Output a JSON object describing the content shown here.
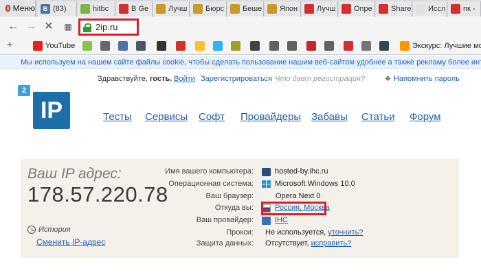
{
  "browser": {
    "menu_label": "Меню",
    "tabs": [
      {
        "label": "(83)",
        "icon": "vk-icon",
        "color": "#4c75a3",
        "glyph": "B"
      },
      {
        "label": "hitbc",
        "icon": "android-icon",
        "color": "#7cb342",
        "glyph": ""
      },
      {
        "label": "В Ge",
        "icon": "red-logo-icon",
        "color": "#d32f2f",
        "glyph": ""
      },
      {
        "label": "Лучш",
        "icon": "coin-icon",
        "color": "#c79a2b",
        "glyph": ""
      },
      {
        "label": "Бюрс",
        "icon": "coin-icon",
        "color": "#c79a2b",
        "glyph": ""
      },
      {
        "label": "Беше",
        "icon": "coin-icon",
        "color": "#c79a2b",
        "glyph": ""
      },
      {
        "label": "Япон",
        "icon": "coin-icon",
        "color": "#c79a2b",
        "glyph": ""
      },
      {
        "label": "Лучш",
        "icon": "red-logo-icon",
        "color": "#d32f2f",
        "glyph": ""
      },
      {
        "label": "Опре",
        "icon": "red-logo-icon",
        "color": "#d32f2f",
        "glyph": ""
      },
      {
        "label": "Share",
        "icon": "red-logo-icon",
        "color": "#d32f2f",
        "glyph": ""
      },
      {
        "label": "Иссл",
        "icon": "sun-icon",
        "color": "#e0e0e0",
        "glyph": ""
      },
      {
        "label": "пк -",
        "icon": "red-circle-icon",
        "color": "#d32f2f",
        "glyph": ""
      }
    ],
    "address": "2ip.ru",
    "bookmarks": [
      {
        "label": "YouTube",
        "icon": "youtube-icon",
        "color": "#e62117"
      },
      {
        "label": "",
        "icon": "play-icon",
        "color": "#8bc34a"
      },
      {
        "label": "",
        "icon": "gamepad-icon",
        "color": "#666666"
      },
      {
        "label": "",
        "icon": "vk-icon",
        "color": "#4c75a3"
      },
      {
        "label": "",
        "icon": "disc-icon",
        "color": "#455a64"
      },
      {
        "label": "",
        "icon": "torrent-icon",
        "color": "#333333"
      },
      {
        "label": "",
        "icon": "red-logo-icon",
        "color": "#d32f2f"
      },
      {
        "label": "",
        "icon": "banana-icon",
        "color": "#fbc02d"
      },
      {
        "label": "",
        "icon": "k-icon",
        "color": "#29b6f6"
      },
      {
        "label": "",
        "icon": "nhl-icon",
        "color": "#9e9d24"
      },
      {
        "label": "",
        "icon": "ball-icon",
        "color": "#424242"
      },
      {
        "label": "",
        "icon": "document-icon",
        "color": "#616161"
      },
      {
        "label": "",
        "icon": "document-icon",
        "color": "#616161"
      },
      {
        "label": "",
        "icon": "mail-icon",
        "color": "#c62828"
      },
      {
        "label": "",
        "icon": "document-icon",
        "color": "#616161"
      },
      {
        "label": "",
        "icon": "red-logo-icon",
        "color": "#d32f2f"
      },
      {
        "label": "",
        "icon": "cart-icon",
        "color": "#757575"
      },
      {
        "label": "",
        "icon": "steam-icon",
        "color": "#37474f"
      },
      {
        "label": "Экскурс: Лучшие мо",
        "icon": "excursion-icon",
        "color": "#ff9800"
      }
    ],
    "cookie_notice": "Мы используем на нашем сайте файлы cookie, чтобы сделать пользование нашим веб-сайтом удобнее а также рекламу более интересной"
  },
  "header": {
    "greeting_prefix": "Здравствуйте, ",
    "guest": "гость.",
    "login": "Войти",
    "register": "Зарегистрироваться",
    "register_hint": "Что дает регистрация?",
    "remind_password": "Напомнить пароль"
  },
  "logo": {
    "badge": "2",
    "text": "IP"
  },
  "nav": {
    "tests": "Тесты",
    "services": "Сервисы",
    "soft": "Софт",
    "providers": "Провайдеры",
    "fun": "Забавы",
    "articles": "Статьи",
    "forum": "Форум"
  },
  "info": {
    "ip_label": "Ваш IP адрес:",
    "ip_value": "178.57.220.78",
    "history": "История",
    "change_ip": "Сменить IP-адрес",
    "rows": [
      {
        "label": "Имя вашего компьютера:",
        "value": "hosted-by.ihc.ru",
        "icon": "computer-icon"
      },
      {
        "label": "Операционная система:",
        "value": "Microsoft Windows 10.0",
        "icon": "windows-icon"
      },
      {
        "label": "Ваш браузер:",
        "value": "Opera Next 0",
        "icon": "opera-icon"
      },
      {
        "label": "Откуда вы:",
        "value": "Россия, Москва",
        "icon": "location-icon"
      },
      {
        "label": "Ваш провайдер:",
        "value": "IHC",
        "icon": "provider-icon"
      },
      {
        "label": "Прокси:",
        "value": "Не используется,",
        "link": "уточнить?",
        "icon": ""
      },
      {
        "label": "Защита данных:",
        "value": "Отсутствует,",
        "link": "исправить?",
        "icon": ""
      }
    ]
  },
  "colors": {
    "accent": "#1f5fb4",
    "highlight": "#d51f2a",
    "infobox_bg": "#f4f0ea",
    "logo_blue": "#1c6fa8"
  }
}
